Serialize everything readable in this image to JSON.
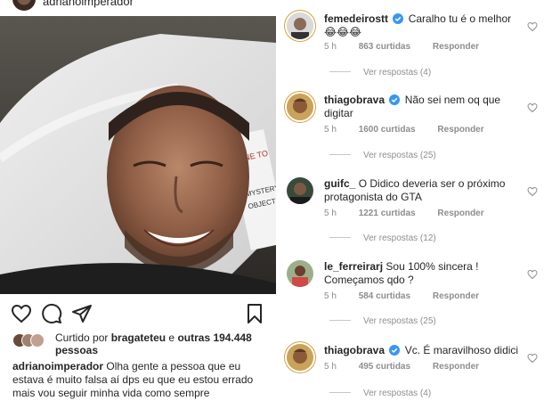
{
  "post": {
    "author": "adrianoimperador",
    "liked_by_prefix": "Curtido por",
    "liked_by_user": "bragateteu",
    "liked_by_and": "e",
    "liked_by_others": "outras 194.448",
    "liked_by_suffix": "pessoas",
    "caption_user": "adrianoimperador",
    "caption_text": "Olha gente a pessoa que eu estava é muito falsa aí dps eu que eu estou errado mais vou seguir minha vida como sempre"
  },
  "comments": [
    {
      "user": "femedeirostt",
      "verified": true,
      "text": "Caralho tu é o melhor 😂😂😂",
      "time": "5 h",
      "likes": "863 curtidas",
      "reply": "Responder",
      "view_replies": "Ver respostas (4)"
    },
    {
      "user": "thiagobrava",
      "verified": true,
      "text": "Não sei nem oq que digitar",
      "time": "5 h",
      "likes": "1600 curtidas",
      "reply": "Responder",
      "view_replies": "Ver respostas (25)"
    },
    {
      "user": "guifc_",
      "verified": false,
      "text": "O Didico deveria ser o próximo protagonista do GTA",
      "time": "5 h",
      "likes": "1221 curtidas",
      "reply": "Responder",
      "view_replies": "Ver respostas (12)"
    },
    {
      "user": "le_ferreirarj",
      "verified": false,
      "text": "Sou 100% sincera ! Começamos qdo ?",
      "time": "5 h",
      "likes": "584 curtidas",
      "reply": "Responder",
      "view_replies": "Ver respostas (25)"
    },
    {
      "user": "thiagobrava",
      "verified": true,
      "text": "Vc. É maravilhoso didici",
      "time": "5 h",
      "likes": "495 curtidas",
      "reply": "Responder",
      "view_replies": "Ver respostas (4)"
    }
  ],
  "icons": {
    "like": "heart-icon",
    "comment": "comment-icon",
    "share": "share-icon",
    "save": "bookmark-icon"
  },
  "colors": {
    "verified": "#3897f0",
    "muted": "#8e8e8e",
    "text": "#262626"
  }
}
